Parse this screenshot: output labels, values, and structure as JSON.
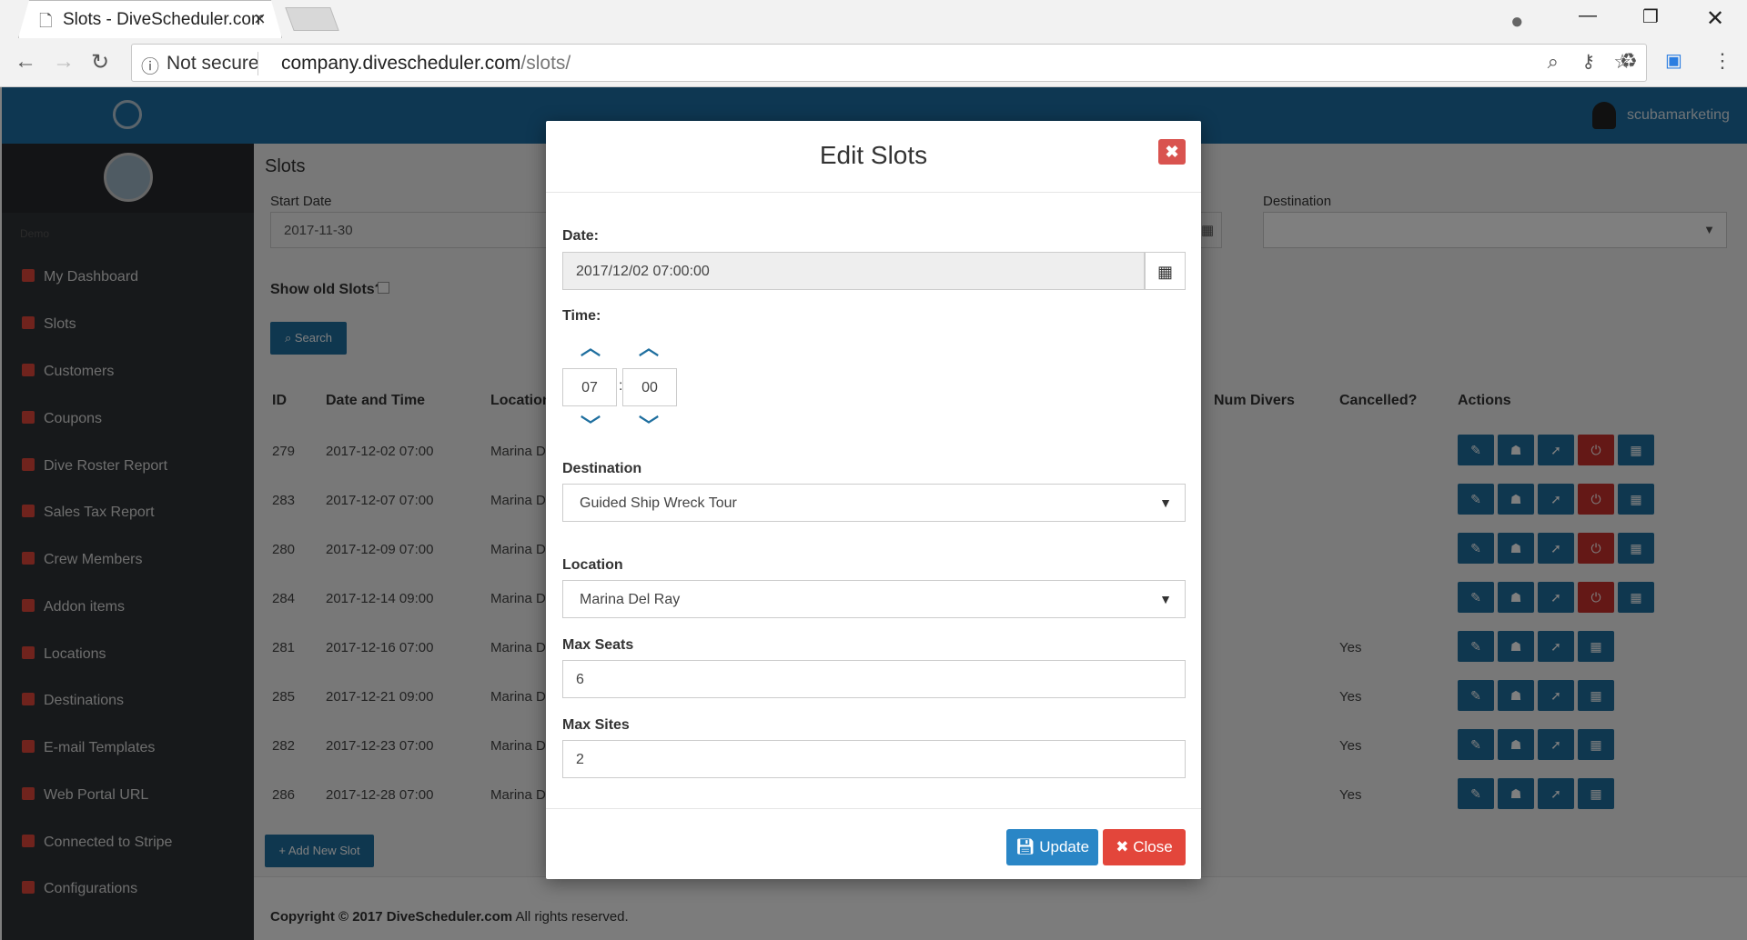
{
  "browser": {
    "tab_title": "Slots - DiveScheduler.com",
    "security_label": "Not secure",
    "url_host": "company.divescheduler.com",
    "url_path": "/slots/"
  },
  "topbar": {
    "username": "scubamarketing"
  },
  "sidebar": {
    "section": "Demo",
    "items": [
      "My Dashboard",
      "Slots",
      "Customers",
      "Coupons",
      "Dive Roster Report",
      "Sales Tax Report",
      "Crew Members",
      "Addon items",
      "Locations",
      "Destinations",
      "E-mail Templates",
      "Web Portal URL",
      "Connected to Stripe",
      "Configurations"
    ]
  },
  "page": {
    "title": "Slots",
    "start_date_label": "Start Date",
    "start_date_value": "2017-11-30",
    "destination_label": "Destination",
    "show_old_label": "Show old Slots?",
    "search_label": "Search",
    "add_new_label": "Add New Slot",
    "footer_bold": "Copyright © 2017 DiveScheduler.com",
    "footer_rest": " All rights reserved."
  },
  "table": {
    "headers": {
      "id": "ID",
      "datetime": "Date and Time",
      "location": "Location",
      "num_divers": "Num Divers",
      "cancelled": "Cancelled?",
      "actions": "Actions"
    },
    "rows": [
      {
        "id": "279",
        "datetime": "2017-12-02 07:00",
        "location": "Marina D",
        "cancelled": ""
      },
      {
        "id": "283",
        "datetime": "2017-12-07 07:00",
        "location": "Marina D",
        "cancelled": ""
      },
      {
        "id": "280",
        "datetime": "2017-12-09 07:00",
        "location": "Marina D",
        "cancelled": ""
      },
      {
        "id": "284",
        "datetime": "2017-12-14 09:00",
        "location": "Marina D",
        "cancelled": ""
      },
      {
        "id": "281",
        "datetime": "2017-12-16 07:00",
        "location": "Marina D",
        "cancelled": "Yes"
      },
      {
        "id": "285",
        "datetime": "2017-12-21 09:00",
        "location": "Marina D",
        "cancelled": "Yes"
      },
      {
        "id": "282",
        "datetime": "2017-12-23 07:00",
        "location": "Marina D",
        "cancelled": "Yes"
      },
      {
        "id": "286",
        "datetime": "2017-12-28 07:00",
        "location": "Marina D",
        "cancelled": "Yes"
      }
    ]
  },
  "modal": {
    "title": "Edit Slots",
    "date_label": "Date:",
    "date_value": "2017/12/02 07:00:00",
    "time_label": "Time:",
    "hour": "07",
    "minute": "00",
    "time_sep": ":",
    "destination_label": "Destination",
    "destination_value": "Guided Ship Wreck Tour",
    "location_label": "Location",
    "location_value": "Marina Del Ray",
    "max_seats_label": "Max Seats",
    "max_seats_value": "6",
    "max_sites_label": "Max Sites",
    "max_sites_value": "2",
    "update_label": "Update",
    "close_label": "Close"
  },
  "colors": {
    "primary": "#1f6f9f",
    "danger": "#d9534f",
    "sidebar": "#2f3236",
    "topbar": "#1c6ea4"
  }
}
